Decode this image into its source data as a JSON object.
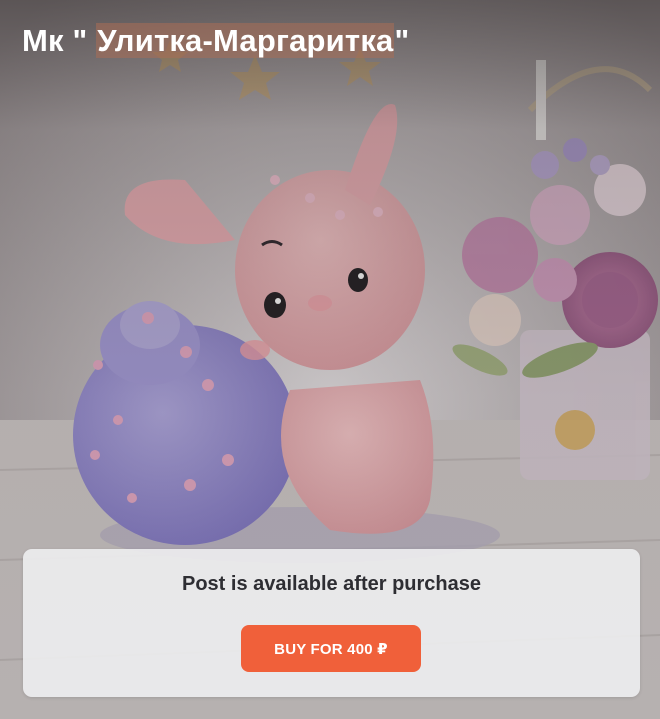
{
  "post": {
    "title_prefix": "Мк \" ",
    "title_highlight": "Улитка-Маргаритка",
    "title_suffix": "\"",
    "image_subject": "pink crochet plush snail toy with lilac shell beside a flower bouquet"
  },
  "paywall": {
    "message": "Post is available after purchase",
    "buy_label": "BUY FOR 400 ₽"
  },
  "colors": {
    "accent_button": "#f0603a",
    "title_text": "#ffffff",
    "paywall_bg": "#ececee",
    "paywall_text": "#2e2e33"
  }
}
